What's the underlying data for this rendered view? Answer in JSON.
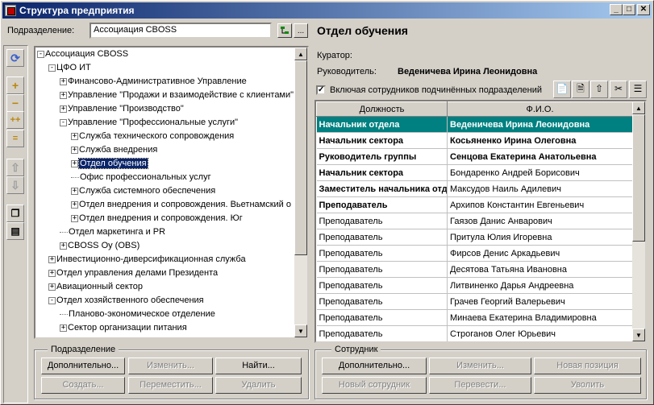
{
  "window": {
    "title": "Структура предприятия",
    "btn_min": "_",
    "btn_max": "□",
    "btn_close": "✕"
  },
  "subdivision": {
    "label": "Подразделение:",
    "value": "Ассоциация CBOSS",
    "browse": "..."
  },
  "tree": {
    "nodes": [
      {
        "text": "Ассоциация CBOSS",
        "state": "-"
      },
      {
        "text": "ЦФО ИТ",
        "state": "-"
      },
      {
        "text": "Финансово-Административное Управление",
        "state": "+"
      },
      {
        "text": "Управление \"Продажи и взаимодействие с клиентами\"",
        "state": "+"
      },
      {
        "text": "Управление \"Производство\"",
        "state": "+"
      },
      {
        "text": "Управление \"Профессиональные услуги\"",
        "state": "-"
      },
      {
        "text": "Служба технического сопровождения",
        "state": "+"
      },
      {
        "text": "Служба внедрения",
        "state": "+"
      },
      {
        "text": "Отдел обучения",
        "state": "+"
      },
      {
        "text": "Офис профессиональных услуг",
        "state": ""
      },
      {
        "text": "Служба системного обеспечения",
        "state": "+"
      },
      {
        "text": "Отдел внедрения и сопровождения. Вьетнамский о",
        "state": "+"
      },
      {
        "text": "Отдел внедрения и сопровождения. Юг",
        "state": "+"
      },
      {
        "text": "Отдел маркетинга и PR",
        "state": ""
      },
      {
        "text": "CBOSS Oy (OBS)",
        "state": "+"
      },
      {
        "text": "Инвестиционно-диверсификационная служба",
        "state": "+"
      },
      {
        "text": "Отдел управления делами Президента",
        "state": "+"
      },
      {
        "text": "Авиационный сектор",
        "state": "+"
      },
      {
        "text": "Отдел хозяйственного обеспечения",
        "state": "-"
      },
      {
        "text": "Планово-экономическое отделение",
        "state": ""
      },
      {
        "text": "Сектор организации питания",
        "state": "+"
      }
    ]
  },
  "left_group": {
    "title": "Подразделение",
    "buttons": [
      "Дополнительно...",
      "Изменить...",
      "Найти...",
      "Создать...",
      "Переместить...",
      "Удалить"
    ]
  },
  "details": {
    "heading": "Отдел обучения",
    "curator_label": "Куратор:",
    "curator_value": "",
    "head_label": "Руководитель:",
    "head_value": "Веденичева Ирина Леонидовна",
    "include_checkbox": "Включая сотрудников подчинённых подразделений",
    "include_checked": true
  },
  "grid": {
    "col_position": "Должность",
    "col_name": "Ф.И.О.",
    "rows": [
      {
        "position": "Начальник отдела",
        "name": "Веденичева Ирина Леонидовна",
        "style": "hl"
      },
      {
        "position": "Начальник сектора",
        "name": "Косьяненко Ирина Олеговна",
        "style": "bold"
      },
      {
        "position": "Руководитель группы",
        "name": "Сенцова Екатерина Анатольевна",
        "style": "bold"
      },
      {
        "position": "Начальник сектора",
        "name": "Бондаренко Андрей Борисович",
        "style": "posbold"
      },
      {
        "position": "Заместитель начальника отдела",
        "name": "Максудов Наиль Адилевич",
        "style": "posbold"
      },
      {
        "position": "Преподаватель",
        "name": "Архипов Константин Евгеньевич",
        "style": "posbold"
      },
      {
        "position": "Преподаватель",
        "name": "Гаязов Данис Анварович",
        "style": ""
      },
      {
        "position": "Преподаватель",
        "name": "Притула Юлия Игоревна",
        "style": ""
      },
      {
        "position": "Преподаватель",
        "name": "Фирсов Денис Аркадьевич",
        "style": ""
      },
      {
        "position": "Преподаватель",
        "name": "Десятова Татьяна Ивановна",
        "style": ""
      },
      {
        "position": "Преподаватель",
        "name": "Литвиненко Дарья Андреевна",
        "style": ""
      },
      {
        "position": "Преподаватель",
        "name": "Грачев Георгий Валерьевич",
        "style": ""
      },
      {
        "position": "Преподаватель",
        "name": "Минаева Екатерина Владимировна",
        "style": ""
      },
      {
        "position": "Преподаватель",
        "name": "Строганов Олег Юрьевич",
        "style": ""
      }
    ]
  },
  "right_group": {
    "title": "Сотрудник",
    "buttons": [
      "Дополнительно...",
      "Изменить...",
      "Новая позиция",
      "Новый сотрудник",
      "Перевести...",
      "Уволить"
    ]
  },
  "icons": {
    "refresh": "refresh-icon",
    "expand": "plus-icon",
    "collapse": "minus-icon",
    "expand_all": "expand-all-icon",
    "collapse_all": "collapse-all-icon",
    "up": "arrow-up-icon",
    "down": "arrow-down-icon",
    "copy": "copy-icon",
    "doc": "document-icon",
    "hierarchy": "hierarchy-icon"
  },
  "colors": {
    "titlebar": "#0a246a",
    "highlight_row": "#008080",
    "window": "#d4d0c8"
  }
}
